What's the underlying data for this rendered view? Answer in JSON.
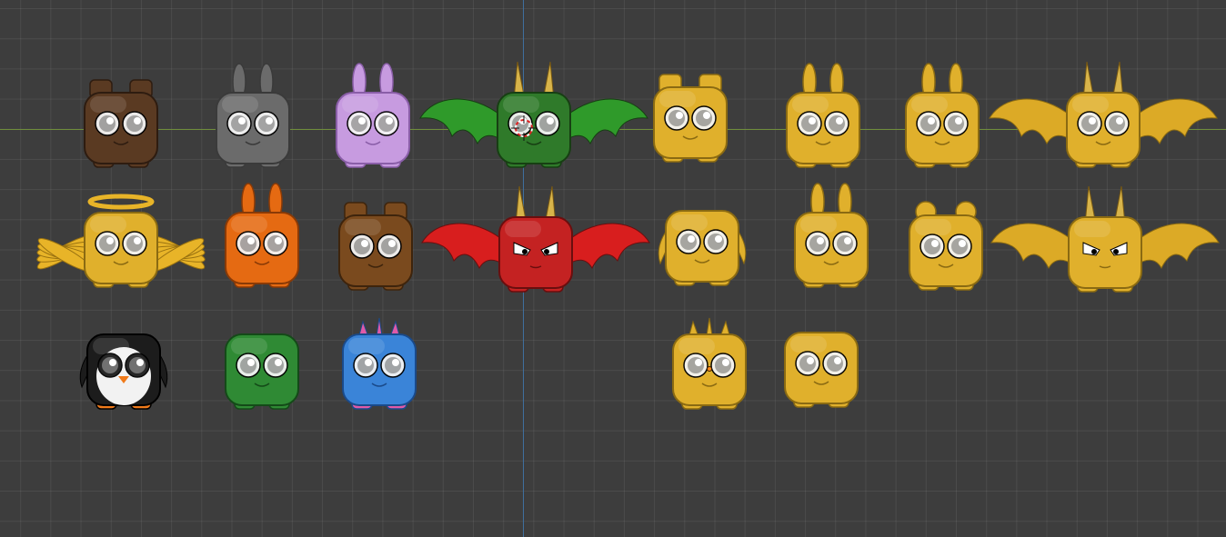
{
  "app": "3D viewport",
  "viewport": {
    "background": "#3d3d3d",
    "grid_color": "rgba(255,255,255,0.07)",
    "axis_x_color": "#6f8d3c",
    "axis_y_color": "#3f6f9e"
  },
  "creatures": [
    {
      "name": "brown-bear",
      "body": "#5a3a22",
      "dark": "#2e1c10",
      "ears": "bear",
      "wings": "none"
    },
    {
      "name": "gray-bunny",
      "body": "#6b6b6b",
      "dark": "#3a3a3a",
      "ears": "bunny",
      "wings": "none"
    },
    {
      "name": "lilac-bunny",
      "body": "#c79be0",
      "dark": "#8a5ea8",
      "ears": "bunny",
      "wings": "none"
    },
    {
      "name": "green-dragon",
      "body": "#2f7a2a",
      "dark": "#173f13",
      "ears": "horns",
      "wings": "bat",
      "wing_color": "#2f9a2a"
    },
    {
      "name": "gold-bear",
      "body": "#e0b02c",
      "dark": "#8a6a12",
      "ears": "bear",
      "wings": "none"
    },
    {
      "name": "gold-bunny",
      "body": "#e0b02c",
      "dark": "#8a6a12",
      "ears": "bunny",
      "wings": "none"
    },
    {
      "name": "gold-bunny-2",
      "body": "#e0b02c",
      "dark": "#8a6a12",
      "ears": "bunny",
      "wings": "none"
    },
    {
      "name": "gold-dragon",
      "body": "#e0b02c",
      "dark": "#8a6a12",
      "ears": "horns",
      "wings": "bat",
      "wing_color": "#dcaa26"
    },
    {
      "name": "gold-angel",
      "body": "#e0b02c",
      "dark": "#8a6a12",
      "ears": "halo",
      "wings": "feather",
      "wing_color": "#e8b428"
    },
    {
      "name": "orange-bunny",
      "body": "#e56a12",
      "dark": "#8a3a06",
      "ears": "bunny",
      "wings": "none"
    },
    {
      "name": "brown-teddy",
      "body": "#7a4a1e",
      "dark": "#3e240c",
      "ears": "bear",
      "wings": "none"
    },
    {
      "name": "red-demon",
      "body": "#c42222",
      "dark": "#6a0e0e",
      "ears": "horns",
      "wings": "bat",
      "wing_color": "#d81e1e",
      "face": "angry"
    },
    {
      "name": "gold-penguin",
      "body": "#e0b02c",
      "dark": "#8a6a12",
      "ears": "none",
      "wings": "flipper"
    },
    {
      "name": "gold-bunny-3",
      "body": "#e0b02c",
      "dark": "#8a6a12",
      "ears": "bunny",
      "wings": "none"
    },
    {
      "name": "gold-teddy",
      "body": "#e0b02c",
      "dark": "#8a6a12",
      "ears": "round",
      "wings": "none"
    },
    {
      "name": "gold-demon",
      "body": "#e0b02c",
      "dark": "#8a6a12",
      "ears": "horns",
      "wings": "bat",
      "wing_color": "#dcaa26",
      "face": "angry"
    },
    {
      "name": "penguin",
      "body": "#1c1c1c",
      "dark": "#000000",
      "ears": "none",
      "wings": "flipper",
      "belly": "#f2f2f2"
    },
    {
      "name": "green-blob",
      "body": "#2f8a34",
      "dark": "#144a18",
      "ears": "none",
      "wings": "none"
    },
    {
      "name": "blue-unicorn",
      "body": "#3a84d8",
      "dark": "#1a4a8a",
      "ears": "unicorn",
      "wings": "none"
    },
    {
      "name": "gold-unicorn",
      "body": "#e0b02c",
      "dark": "#8a6a12",
      "ears": "unicorn",
      "wings": "none"
    },
    {
      "name": "gold-blob",
      "body": "#e0b02c",
      "dark": "#8a6a12",
      "ears": "none",
      "wings": "none"
    }
  ]
}
